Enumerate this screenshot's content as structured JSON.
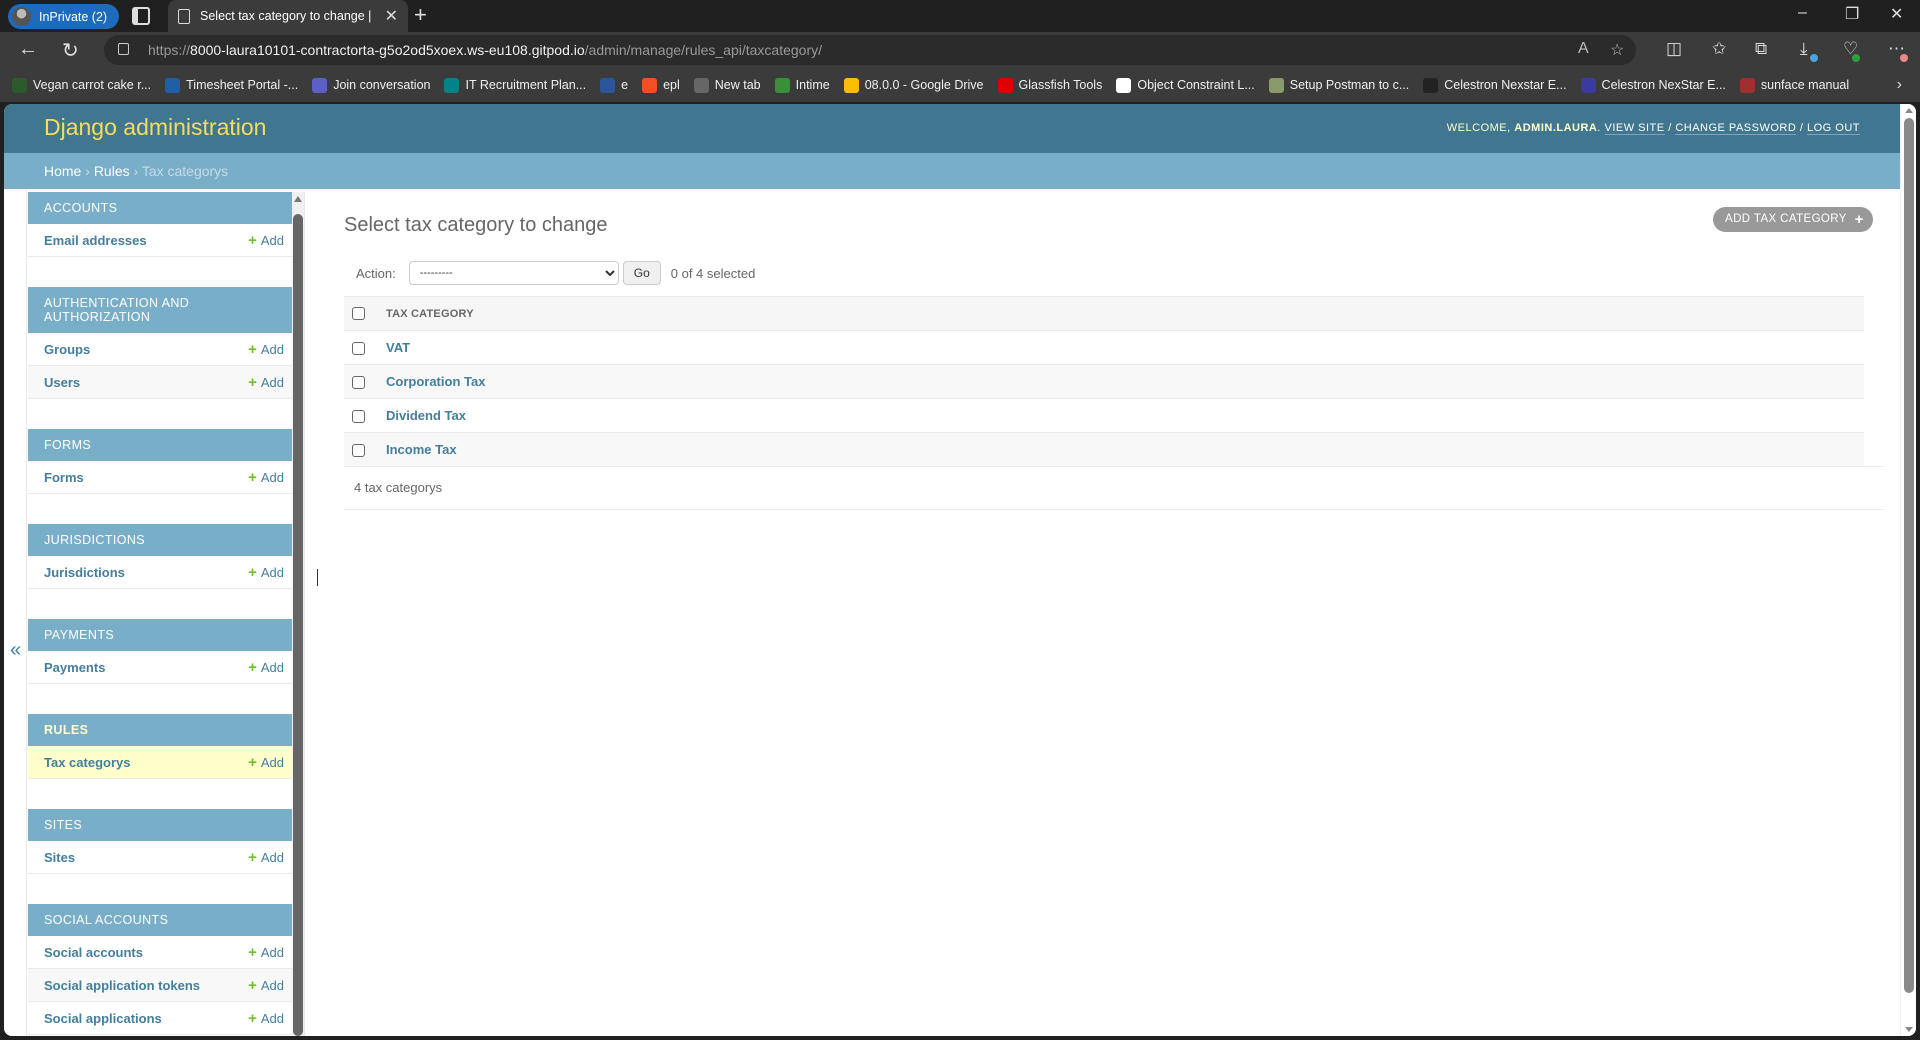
{
  "browser": {
    "profile_label": "InPrivate (2)",
    "tab_title": "Select tax category to change | D",
    "url_scheme": "https://",
    "url_host": "8000-laura10101-contractorta-g5o2od5xoex.ws-eu108.gitpod.io",
    "url_path": "/admin/manage/rules_api/taxcategory/",
    "bookmarks": [
      {
        "label": "Vegan carrot cake r...",
        "color": "#2d5a2d"
      },
      {
        "label": "Timesheet Portal -...",
        "color": "#1f5fa8"
      },
      {
        "label": "Join conversation",
        "color": "#5b5fc7"
      },
      {
        "label": "IT Recruitment Plan...",
        "color": "#038387"
      },
      {
        "label": "e",
        "color": "#2b579a"
      },
      {
        "label": "epl",
        "color": "#f25022"
      },
      {
        "label": "New tab",
        "color": "#666666"
      },
      {
        "label": "Intime",
        "color": "#3a8f3a"
      },
      {
        "label": "08.0.0 - Google Drive",
        "color": "#fbbc04"
      },
      {
        "label": "Glassfish Tools",
        "color": "#e00000"
      },
      {
        "label": "Object Constraint L...",
        "color": "#ffffff"
      },
      {
        "label": "Setup Postman to c...",
        "color": "#8a9a6a"
      },
      {
        "label": "Celestron Nexstar E...",
        "color": "#222222"
      },
      {
        "label": "Celestron NexStar E...",
        "color": "#3a3aa0"
      },
      {
        "label": "sunface manual",
        "color": "#a03030"
      }
    ]
  },
  "header": {
    "branding": "Django administration",
    "welcome": "Welcome,",
    "username": "admin.laura",
    "view_site": "View site",
    "change_password": "Change password",
    "log_out": "Log out",
    "sep": "/"
  },
  "breadcrumbs": {
    "home": "Home",
    "app": "Rules",
    "current": "Tax categorys",
    "sep": "›"
  },
  "sidebar": {
    "toggle": "«",
    "add_label": "Add",
    "modules": [
      {
        "caption": "Accounts",
        "items": [
          "Email addresses"
        ]
      },
      {
        "caption": "Authentication and Authorization",
        "items": [
          "Groups",
          "Users"
        ]
      },
      {
        "caption": "Forms",
        "items": [
          "Forms"
        ]
      },
      {
        "caption": "Jurisdictions",
        "items": [
          "Jurisdictions"
        ]
      },
      {
        "caption": "Payments",
        "items": [
          "Payments"
        ]
      },
      {
        "caption": "Rules",
        "items": [
          "Tax categorys"
        ],
        "current": true
      },
      {
        "caption": "Sites",
        "items": [
          "Sites"
        ]
      },
      {
        "caption": "Social Accounts",
        "items": [
          "Social accounts",
          "Social application tokens",
          "Social applications"
        ]
      }
    ]
  },
  "content": {
    "title": "Select tax category to change",
    "add_button": "Add tax category",
    "action_label": "Action:",
    "action_selected": "---------",
    "go_label": "Go",
    "selection_count": "0 of 4 selected",
    "column_header": "Tax category",
    "rows": [
      "VAT",
      "Corporation Tax",
      "Dividend Tax",
      "Income Tax"
    ],
    "paginator": "4 tax categorys"
  }
}
